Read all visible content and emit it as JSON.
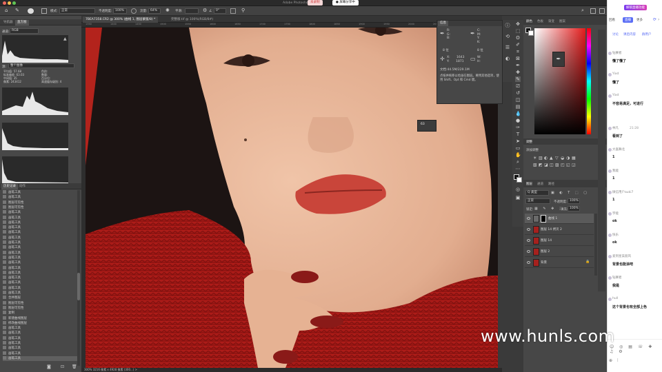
{
  "mac_bar": {
    "app_title": "Adobe Photoshop",
    "recording_label": "未录制",
    "sharing_label": "● 屏幕分享中"
  },
  "options_bar": {
    "mode_label": "模式:",
    "mode_value": "正常",
    "opacity_label": "不透明度:",
    "opacity_value": "100%",
    "flow_label": "流量:",
    "flow_value": "64%",
    "smooth_label": "平滑:",
    "angle_value": "0°"
  },
  "left_panel": {
    "tabs": [
      "导航器",
      "直方图"
    ],
    "channel_label": "通道:",
    "channel_value": "RGB",
    "source_label": "源:",
    "source_value": "整个图像",
    "stats": [
      {
        "label": "平均值:",
        "value": "57.68"
      },
      {
        "label": "标准偏差:",
        "value": "63.03"
      },
      {
        "label": "中间值:",
        "value": "35"
      },
      {
        "label": "像素:",
        "value": "243412"
      }
    ],
    "stats_right": [
      "色阶:",
      "数量:",
      "百分位:",
      "高速缓存级别:"
    ],
    "cache_level": "4",
    "history_tabs": [
      "历史记录",
      "动作"
    ],
    "history_items": [
      "画笔工具",
      "画笔工具",
      "图层可见性",
      "图层可见性",
      "画笔工具",
      "画笔工具",
      "画笔工具",
      "画笔工具",
      "画笔工具",
      "画笔工具",
      "画笔工具",
      "画笔工具",
      "画笔工具",
      "画笔工具",
      "画笔工具",
      "画笔工具",
      "画笔工具",
      "画笔工具",
      "画笔工具",
      "画笔工具",
      "画笔工具",
      "合并图层",
      "图层可见性",
      "图层可见性",
      "复制",
      "新建曲线图层",
      "修改曲线图层",
      "画笔工具",
      "画笔工具",
      "画笔工具",
      "画笔工具",
      "画笔工具",
      "画笔工具",
      "画笔工具"
    ]
  },
  "canvas_tabs": [
    "7BEA7358.CR2 @ 300% (曲线 1, 图层蒙版/8) *",
    "完整版.tif @ 100%(RGB/8#)"
  ],
  "ruler_ticks": [
    "1350",
    "1400",
    "1450",
    "1500",
    "1550",
    "1600",
    "1650",
    "1700",
    "1750",
    "1800",
    "1850",
    "1900",
    "1950",
    "2000",
    "2050",
    "2100",
    "2150"
  ],
  "status_bar": "300%   3216 像素 x 4928 像素 (300...)  >",
  "info_panel": {
    "tab": "信息",
    "rgb_labels": [
      "R:",
      "G:",
      "B:"
    ],
    "cmyk_labels": [
      "C:",
      "M:",
      "Y:",
      "K:"
    ],
    "bit_left": "8 位",
    "bit_right": "8 位",
    "x_label": "X:",
    "x_value": "1643",
    "y_label": "Y:",
    "y_value": "1871",
    "w_label": "W:",
    "h_label": "H:",
    "doc_size": "文档:44.5M/229.1M",
    "hint": "点按并拖移以绘画在图层。要用其他选项，使用 Shift、Opt 和 Cmd 键。",
    "popup_value": "63"
  },
  "right_panel": {
    "color_tabs": [
      "颜色",
      "色板",
      "渐变",
      "图案"
    ],
    "adjust_tab": "调整",
    "adjust_label": "添加调整",
    "layer_tabs": [
      "图层",
      "通道",
      "路径"
    ],
    "filter_label": "Q 类型",
    "blend_mode": "正常",
    "opacity_label": "不透明度:",
    "opacity_value": "100%",
    "lock_label": "锁定:",
    "fill_label": "填充:",
    "fill_value": "100%",
    "layers": [
      "曲线 1",
      "图层 14 拷贝 2",
      "图层 14",
      "图层 2",
      "背景"
    ]
  },
  "chat": {
    "banner": "解锁直播功能",
    "header_left": "回看",
    "header_tabs": [
      "直播",
      "更多"
    ],
    "sub_tabs": [
      "讨论",
      "课后内容",
      "群用户"
    ],
    "time_label": "21:28",
    "messages": [
      {
        "user": "钻赛者",
        "text": "懂了懂了"
      },
      {
        "user": "Yixd",
        "text": "懂了"
      },
      {
        "user": "Yixd",
        "text": "不容易满足，可进行"
      },
      {
        "user": "林凡",
        "text": "看到了"
      },
      {
        "user": "大喜舞北",
        "text": "1"
      },
      {
        "user": "我能",
        "text": "1"
      },
      {
        "user": "微信用户auki7",
        "text": "1"
      },
      {
        "user": "宇能",
        "text": "ok"
      },
      {
        "user": "快乐",
        "text": "ok"
      },
      {
        "user": "爱到星美丽风",
        "text": "背景也能涂吧"
      },
      {
        "user": "钻赛者",
        "text": "我是"
      },
      {
        "user": "hull",
        "text": "这个背景也有全部上色"
      }
    ]
  },
  "watermark": "www.hunls.com"
}
